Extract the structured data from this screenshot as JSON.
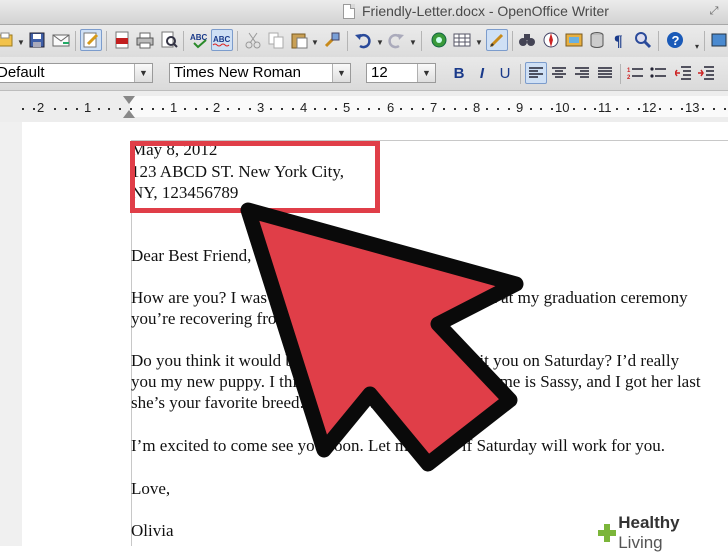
{
  "window": {
    "title": "Friendly-Letter.docx - OpenOffice Writer"
  },
  "format_toolbar": {
    "paragraph_style": "Default",
    "font_name": "Times New Roman",
    "font_size": "12",
    "bold_label": "B",
    "italic_label": "I",
    "underline_label": "U"
  },
  "ruler": {
    "labels": [
      "2",
      "1",
      "1",
      "2",
      "3",
      "4",
      "5",
      "6",
      "7",
      "8",
      "9",
      "10",
      "11",
      "12",
      "13"
    ]
  },
  "document": {
    "lines": [
      "May 8, 2012",
      "123 ABCD ST. New York City,",
      "NY, 123456789",
      "Dear Best Friend,",
      "How are you? I was so happy to see you and Grandpa at my graduation ceremony",
      "you’re recovering from",
      "Do you think it would be okay if I came over to visit you on Saturday? I’d really",
      "you my new puppy. I think you would like her. Her name is Sassy, and I got her last",
      "she’s your favorite breed: a yellow lab, just like Kimo!",
      "I’m excited to come see you soon. Let me know if Saturday will work for you.",
      "Love,",
      "Olivia"
    ]
  },
  "annotation": {
    "highlight_color": "#e03e48",
    "arrow_fill": "#e03e48",
    "arrow_stroke": "#0a0a0a"
  },
  "watermark": {
    "brand_bold": "Healthy",
    "brand_rest": " Living",
    "accent": "#7bb53a"
  }
}
